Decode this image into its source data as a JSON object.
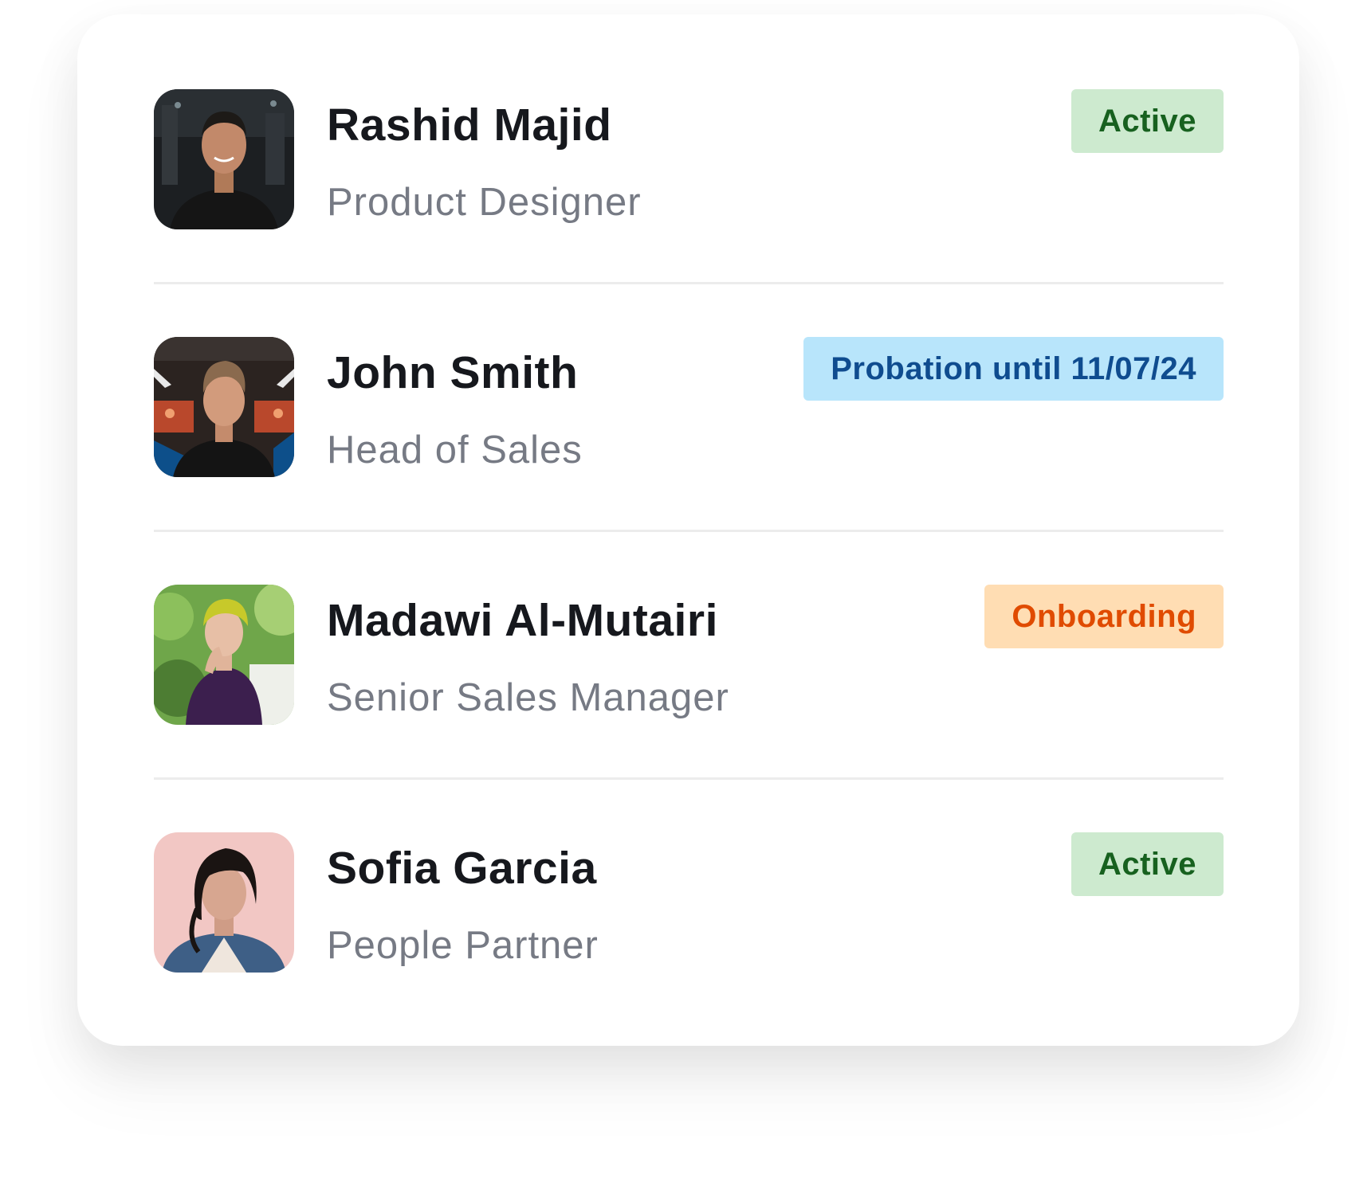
{
  "employees": [
    {
      "name": "Rashid Majid",
      "role": "Product Designer",
      "status": "Active",
      "status_type": "active"
    },
    {
      "name": "John Smith",
      "role": "Head of Sales",
      "status": "Probation until 11/07/24",
      "status_type": "probation"
    },
    {
      "name": "Madawi Al-Mutairi",
      "role": "Senior Sales Manager",
      "status": "Onboarding",
      "status_type": "onboarding"
    },
    {
      "name": "Sofia Garcia",
      "role": "People Partner",
      "status": "Active",
      "status_type": "active"
    }
  ],
  "colors": {
    "active_bg": "#cdeacf",
    "active_text": "#17611f",
    "probation_bg": "#b8e5fb",
    "probation_text": "#0f4c8f",
    "onboarding_bg": "#ffddb3",
    "onboarding_text": "#e04b00"
  }
}
